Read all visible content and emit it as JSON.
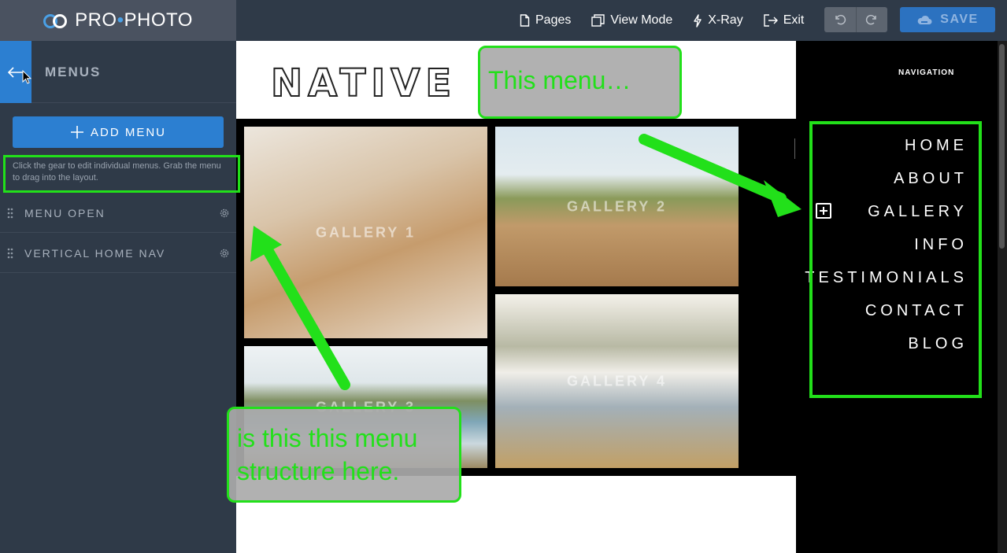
{
  "app": {
    "logo_left": "PRO",
    "logo_dot": "•",
    "logo_right": "PHOTO"
  },
  "toolbar": {
    "pages": "Pages",
    "view_mode": "View Mode",
    "xray": "X-Ray",
    "exit": "Exit",
    "save": "SAVE"
  },
  "sidebar": {
    "title": "MENUS",
    "add_menu": "ADD MENU",
    "help": "Click the gear to edit individual menus. Grab the menu to drag into the layout.",
    "menus": [
      {
        "label": "MENU OPEN"
      },
      {
        "label": "VERTICAL HOME NAV"
      }
    ]
  },
  "canvas": {
    "site_logo": "NATIVE",
    "galleries": [
      {
        "label": "GALLERY 1"
      },
      {
        "label": "GALLERY 2"
      },
      {
        "label": "GALLERY 3"
      },
      {
        "label": "GALLERY 4"
      }
    ]
  },
  "nav_panel": {
    "title": "NAVIGATION",
    "items": [
      "HOME",
      "ABOUT",
      "GALLERY",
      "INFO",
      "TESTIMONIALS",
      "CONTACT",
      "BLOG"
    ]
  },
  "annotations": {
    "note1": "This menu…",
    "note2_line1": "is this this menu",
    "note2_line2": "structure here."
  },
  "colors": {
    "topbar": "#2f3a48",
    "accent_blue": "#2c7fd1",
    "annotation_green": "#22e01a"
  }
}
